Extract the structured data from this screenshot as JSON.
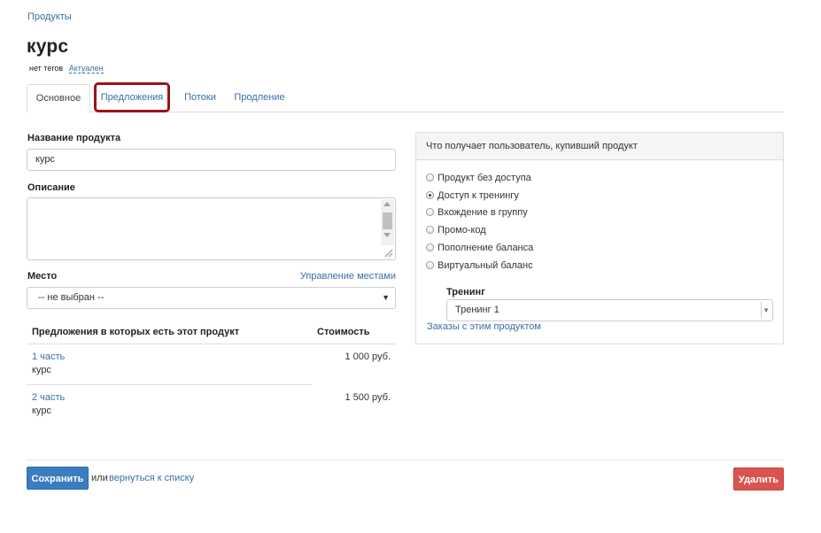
{
  "breadcrumb": {
    "label": "Продукты"
  },
  "product": {
    "title": "курс",
    "tags": "нет тегов",
    "status": "Актуален"
  },
  "tabs": [
    {
      "label": "Основное",
      "active": true
    },
    {
      "label": "Предложения",
      "highlighted": true
    },
    {
      "label": "Потоки"
    },
    {
      "label": "Продление"
    }
  ],
  "form": {
    "name_label": "Название продукта",
    "name_value": "курс",
    "description_label": "Описание",
    "description_value": "",
    "place_label": "Место",
    "manage_places_link": "Управление местами",
    "place_selected": "-- не выбран --"
  },
  "offers": {
    "header_name": "Предложения в которых есть этот продукт",
    "header_price": "Стоимость",
    "rows": [
      {
        "name": "1 часть",
        "product": "курс",
        "price": "1 000 руб."
      },
      {
        "name": "2 часть",
        "product": "курс",
        "price": "1 500 руб."
      }
    ]
  },
  "access_panel": {
    "title": "Что получает пользователь, купивший продукт",
    "options": [
      {
        "label": "Продукт без доступа",
        "checked": false
      },
      {
        "label": "Доступ к тренингу",
        "checked": true
      },
      {
        "label": "Вхождение в группу",
        "checked": false
      },
      {
        "label": "Промо-код",
        "checked": false
      },
      {
        "label": "Пополнение баланса",
        "checked": false
      },
      {
        "label": "Виртуальный баланс",
        "checked": false
      }
    ],
    "training_label": "Тренинг",
    "training_selected": "Тренинг 1",
    "orders_link": "Заказы с этим продуктом"
  },
  "footer": {
    "save_label": "Сохранить",
    "or_text": "или",
    "back_link": "вернуться к списку",
    "delete_label": "Удалить"
  },
  "colors": {
    "link": "#3a6ea5",
    "primary": "#3a7cc0",
    "danger": "#d9534f",
    "highlight": "#9b1414"
  }
}
